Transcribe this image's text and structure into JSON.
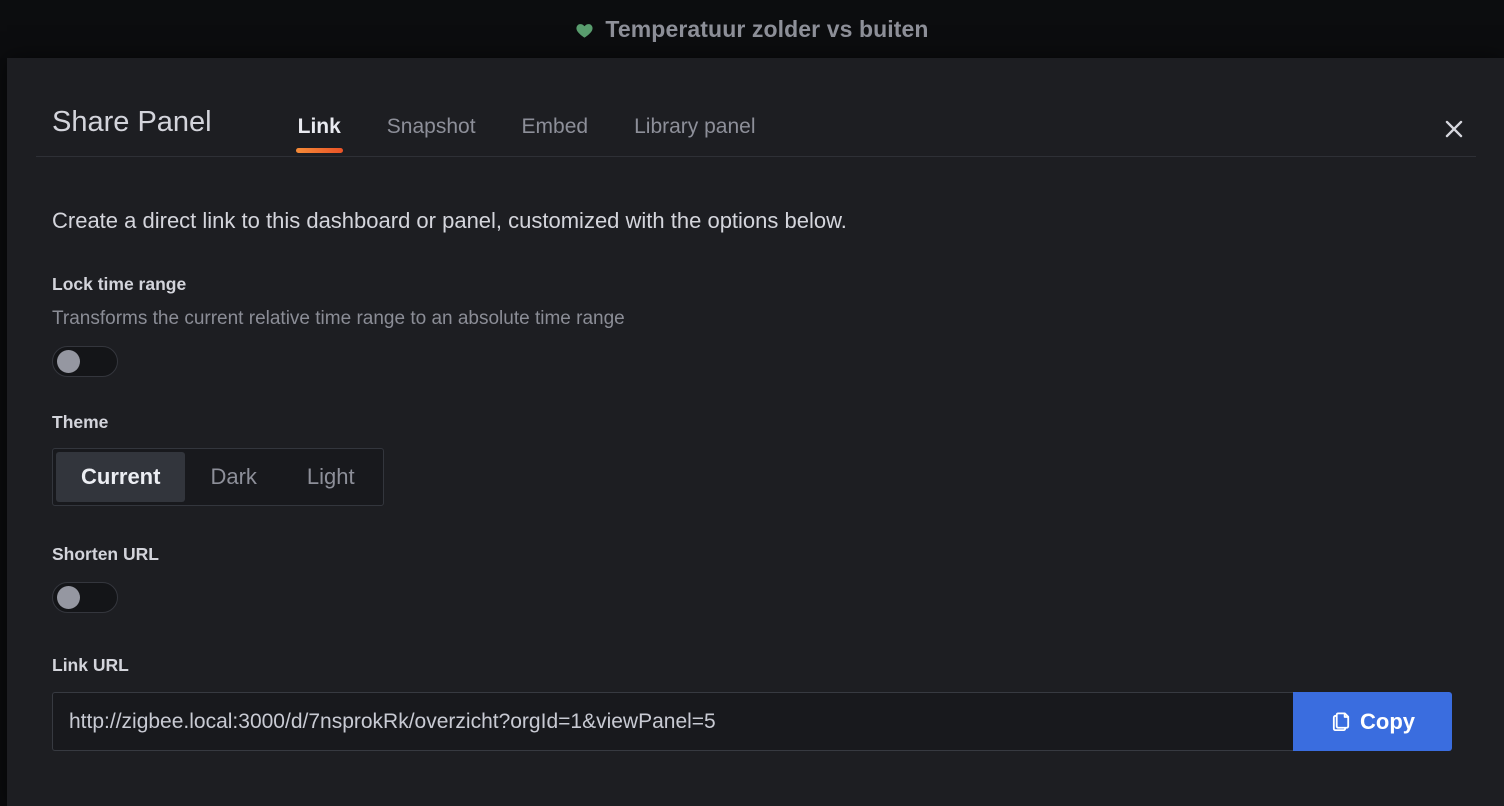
{
  "dashboard": {
    "title": "Temperatuur zolder vs buiten",
    "favorite_icon": "heart-icon",
    "heart_color": "#5a9e6f"
  },
  "modal": {
    "title": "Share Panel",
    "close_icon": "close-icon",
    "tabs": [
      {
        "label": "Link",
        "active": true
      },
      {
        "label": "Snapshot",
        "active": false
      },
      {
        "label": "Embed",
        "active": false
      },
      {
        "label": "Library panel",
        "active": false
      }
    ],
    "active_tab_underline_color": "#ea5327",
    "intro": "Create a direct link to this dashboard or panel, customized with the options below.",
    "lock_time_range": {
      "label": "Lock time range",
      "description": "Transforms the current relative time range to an absolute time range",
      "enabled": false
    },
    "theme": {
      "label": "Theme",
      "options": [
        "Current",
        "Dark",
        "Light"
      ],
      "selected": "Current"
    },
    "shorten_url": {
      "label": "Shorten URL",
      "enabled": false
    },
    "link_url": {
      "label": "Link URL",
      "value": "http://zigbee.local:3000/d/7nsprokRk/overzicht?orgId=1&viewPanel=5",
      "placeholder": "",
      "copy_label": "Copy",
      "copy_icon": "copy-icon",
      "copy_color": "#3a6ddf"
    }
  }
}
